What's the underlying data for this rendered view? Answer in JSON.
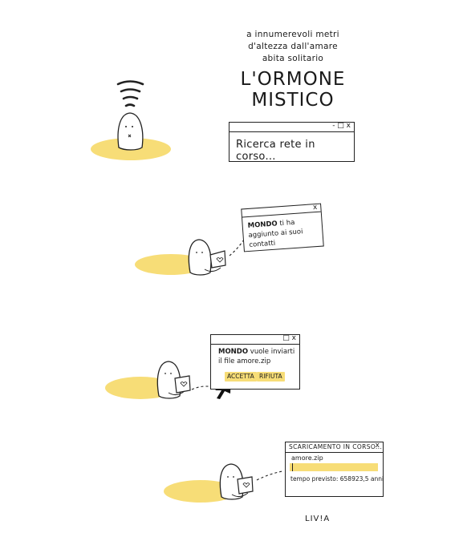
{
  "heading": {
    "line1": "a innumerevoli metri",
    "line2": "d'altezza dall'amare",
    "line3": "abita solitario",
    "title1": "L'ORMONE",
    "title2": "MISTICO"
  },
  "panel1": {
    "window_controls": "- □ x",
    "message": "Ricerca rete in corso..."
  },
  "panel2": {
    "window_controls": "x",
    "sender": "MONDO",
    "message": "ti ha aggiunto ai suoi contatti"
  },
  "panel3": {
    "window_controls": "□ x",
    "sender": "MONDO",
    "message_a": "vuole inviarti",
    "message_b": "il file",
    "file": "amore.zip",
    "accept_label": "ACCETTA",
    "refuse_label": "RIFIUTA"
  },
  "panel4": {
    "window_title": "SCARICAMENTO IN CORSO...",
    "window_controls": "x",
    "file": "amore.zip",
    "progress": 0.02,
    "eta": "tempo previsto: 658923,5 anni"
  },
  "signature": "LIV!A",
  "colors": {
    "accent": "#f7dd77",
    "ink": "#1a1a1a",
    "background": "#ffffff"
  }
}
